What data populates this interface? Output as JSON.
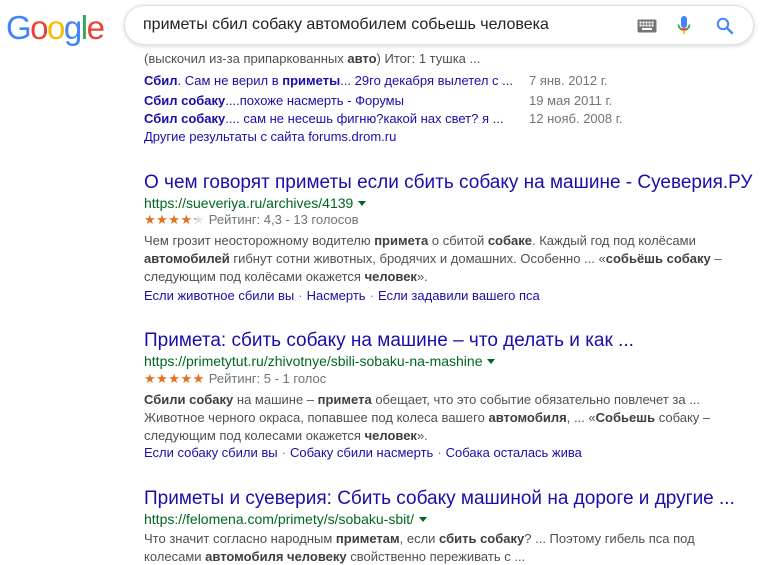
{
  "logo": {
    "text": "Google"
  },
  "search": {
    "query": "приметы сбил собаку автомобилем собьешь человека"
  },
  "icons": {
    "keyboard": "keyboard-icon",
    "mic": "microphone-icon",
    "search": "search-icon"
  },
  "colors": {
    "link": "#1a0dab",
    "url": "#006621",
    "star": "#e7711b",
    "g_blue": "#4285f4",
    "g_red": "#ea4335",
    "g_yellow": "#fbbc05",
    "g_green": "#34a853"
  },
  "top_fragment": {
    "pre": "(выскочил из-за припаркованных ",
    "bold": "авто",
    "post": ") Итог: 1 тушка ..."
  },
  "forum_links": [
    {
      "b1": "Сбил",
      "t1": ". Сам не верил в ",
      "b2": "приметы",
      "t2": "... 29го декабря вылетел с ...",
      "date": "7 янв. 2012 г."
    },
    {
      "b1": "Сбил собаку",
      "t1": "....похоже насмерть - Форумы",
      "b2": "",
      "t2": "",
      "date": "19 мая 2011 г."
    },
    {
      "b1": "Сбил собаку",
      "t1": ".... сам не несешь фигню?какой нах свет? я ...",
      "b2": "",
      "t2": "",
      "date": "12 нояб. 2008 г."
    }
  ],
  "more_results": "Другие результаты с сайта forums.drom.ru",
  "results": [
    {
      "title": "О чем говорят приметы если сбить собаку на машине - Суеверия.РУ",
      "url": "https://sueveriya.ru/archives/4139",
      "rating": {
        "value": 4.3,
        "max": 5,
        "text": "Рейтинг: 4,3 - 13 голосов"
      },
      "snippet_lines": [
        [
          [
            "Чем грозит неосторожному водителю ",
            false
          ],
          [
            "примета",
            true
          ],
          [
            " о сбитой ",
            false
          ],
          [
            "собаке",
            true
          ],
          [
            ". Каждый год под колёсами",
            false
          ]
        ],
        [
          [
            "автомобилей",
            true
          ],
          [
            " гибнут сотни животных, бродячих и домашних. Особенно ... «",
            false
          ],
          [
            "собьёшь собаку",
            true
          ],
          [
            " –",
            false
          ]
        ],
        [
          [
            "следующим под колёсами окажется ",
            false
          ],
          [
            "человек",
            true
          ],
          [
            "».",
            false
          ]
        ]
      ],
      "sitelinks": [
        "Если животное сбили вы",
        "Насмерть",
        "Если задавили вашего пса"
      ]
    },
    {
      "title": "Примета: сбить собаку на машине – что делать и как ...",
      "url": "https://primetytut.ru/zhivotnye/sbili-sobaku-na-mashine",
      "rating": {
        "value": 5,
        "max": 5,
        "text": "Рейтинг: 5 - 1 голос"
      },
      "snippet_lines": [
        [
          [
            "Сбили собаку",
            true
          ],
          [
            " на машине – ",
            false
          ],
          [
            "примета",
            true
          ],
          [
            " обещает, что это событие обязательно повлечет за ...",
            false
          ]
        ],
        [
          [
            "Животное черного окраса, попавшее под колеса вашего ",
            false
          ],
          [
            "автомобиля",
            true
          ],
          [
            ", ... «",
            false
          ],
          [
            "Собьешь",
            true
          ],
          [
            " собаку –",
            false
          ]
        ],
        [
          [
            "следующим под колесами окажется ",
            false
          ],
          [
            "человек",
            true
          ],
          [
            "».",
            false
          ]
        ]
      ],
      "sitelinks": [
        "Если собаку сбили вы",
        "Собаку сбили насмерть",
        "Собака осталась жива"
      ]
    },
    {
      "title": "Приметы и суеверия: Сбить собаку машиной на дороге и другие ...",
      "url": "https://felomena.com/primety/s/sobaku-sbit/",
      "snippet_lines": [
        [
          [
            "Что значит согласно народным ",
            false
          ],
          [
            "приметам",
            true
          ],
          [
            ", если ",
            false
          ],
          [
            "сбить собаку",
            true
          ],
          [
            "? ... Поэтому гибель пса под",
            false
          ]
        ],
        [
          [
            "колесами ",
            false
          ],
          [
            "автомобиля человеку",
            true
          ],
          [
            " свойственно переживать с ...",
            false
          ]
        ]
      ],
      "sitelinks": []
    }
  ]
}
